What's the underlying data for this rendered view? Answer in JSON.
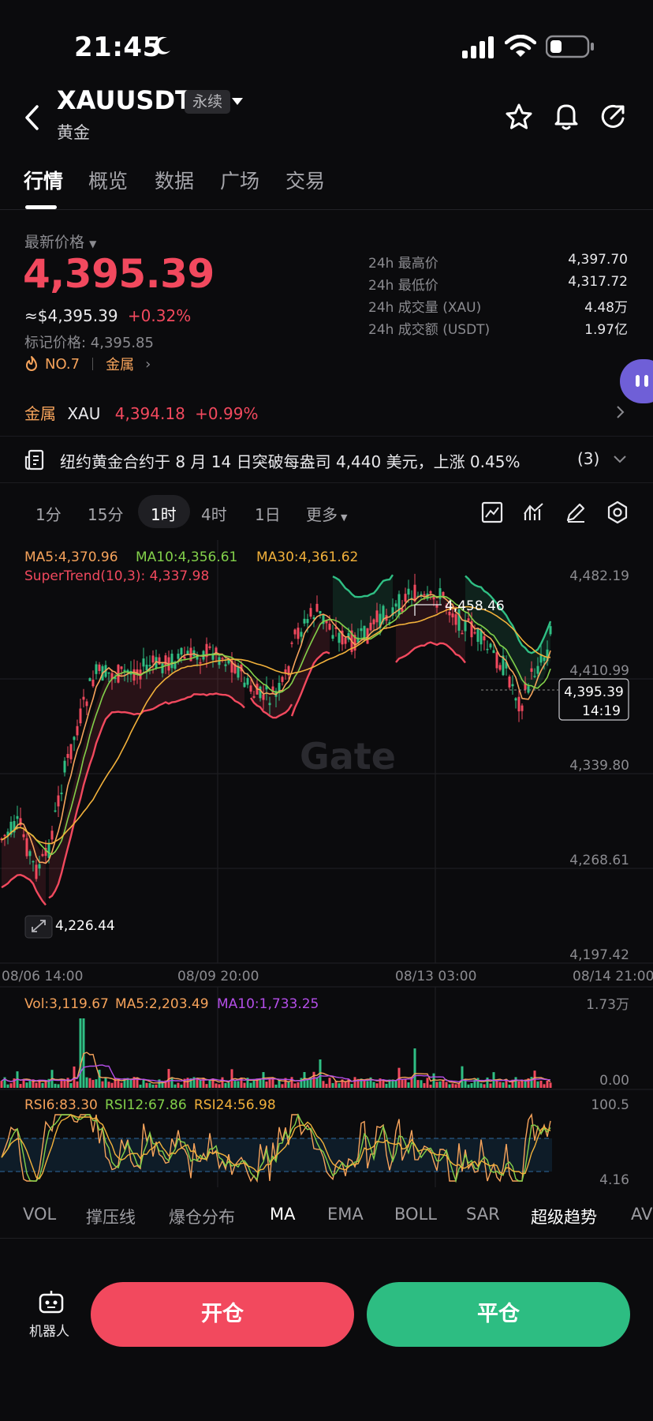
{
  "status_bar": {
    "time": "21:45"
  },
  "header": {
    "symbol": "XAUUSDT",
    "badge": "永续",
    "subtitle": "黄金"
  },
  "tabs": [
    "行情",
    "概览",
    "数据",
    "广场",
    "交易"
  ],
  "price": {
    "latest_label": "最新价格",
    "last": "4,395.39",
    "approx_usd": "≈$4,395.39",
    "change_pct": "+0.32%",
    "mark": "标记价格: 4,395.85",
    "rank": "NO.7",
    "sector": "金属"
  },
  "stats": [
    {
      "label": "24h 最高价",
      "value": "4,397.70"
    },
    {
      "label": "24h 最低价",
      "value": "4,317.72"
    },
    {
      "label": "24h 成交量 (XAU)",
      "value": "4.48万"
    },
    {
      "label": "24h 成交额 (USDT)",
      "value": "1.97亿"
    }
  ],
  "xau_row": {
    "sector": "金属",
    "symbol": "XAU",
    "price": "4,394.18",
    "change": "+0.99%"
  },
  "news": {
    "text": "纽约黄金合约于 8 月 14 日突破每盎司 4,440 美元，上涨 0.45%",
    "count": "(3)"
  },
  "intervals": {
    "items": [
      "1分",
      "15分",
      "1时",
      "4时",
      "1日"
    ],
    "active": "1时",
    "more": "更多"
  },
  "chart": {
    "legend": {
      "ma5": "MA5:4,370.96",
      "ma10": "MA10:4,356.61",
      "ma30": "MA30:4,361.62",
      "supertrend": "SuperTrend(10,3): 4,337.98"
    },
    "price_axis": [
      "4,482.19",
      "4,410.99",
      "4,339.80",
      "4,268.61",
      "4,197.42"
    ],
    "high_marker": "4,458.46",
    "low_marker": "4,226.44",
    "current_price_tag": "4,395.39",
    "countdown": "14:19",
    "time_axis": [
      "08/06 14:00",
      "08/09 20:00",
      "08/13 03:00",
      "08/14 21:00"
    ],
    "volume": {
      "vol": "Vol:3,119.67",
      "ma5": "MA5:2,203.49",
      "ma10": "MA10:1,733.25",
      "axis_top": "1.73万",
      "axis_bottom": "0.00"
    },
    "rsi": {
      "rsi6": "RSI6:83.30",
      "rsi12": "RSI12:67.86",
      "rsi24": "RSI24:56.98",
      "axis_top": "100.5",
      "axis_bottom": "4.16"
    },
    "watermark": "Gate"
  },
  "indicator_tabs": {
    "items": [
      "VOL",
      "撑压线",
      "爆仓分布",
      "MA",
      "EMA",
      "BOLL",
      "SAR",
      "超级趋势",
      "AV"
    ],
    "active": [
      "MA",
      "超级趋势"
    ]
  },
  "bottom": {
    "robot_label": "机器人",
    "open_label": "开仓",
    "close_label": "平仓"
  },
  "colors": {
    "up": "#2fbf84",
    "down": "#f2495e",
    "accent_orange": "#f6a35b",
    "ma10": "#82d04a",
    "ma30": "#f2b13b",
    "vol_ma10": "#b44ee8"
  },
  "icons": [
    "back-arrow-icon",
    "dropdown-caret-icon",
    "star-icon",
    "bell-icon",
    "share-icon",
    "fire-icon",
    "chevron-right-icon",
    "news-icon",
    "chevron-down-icon",
    "chart-type-icon",
    "indicator-icon",
    "draw-icon",
    "settings-icon",
    "expand-icon",
    "robot-icon"
  ]
}
